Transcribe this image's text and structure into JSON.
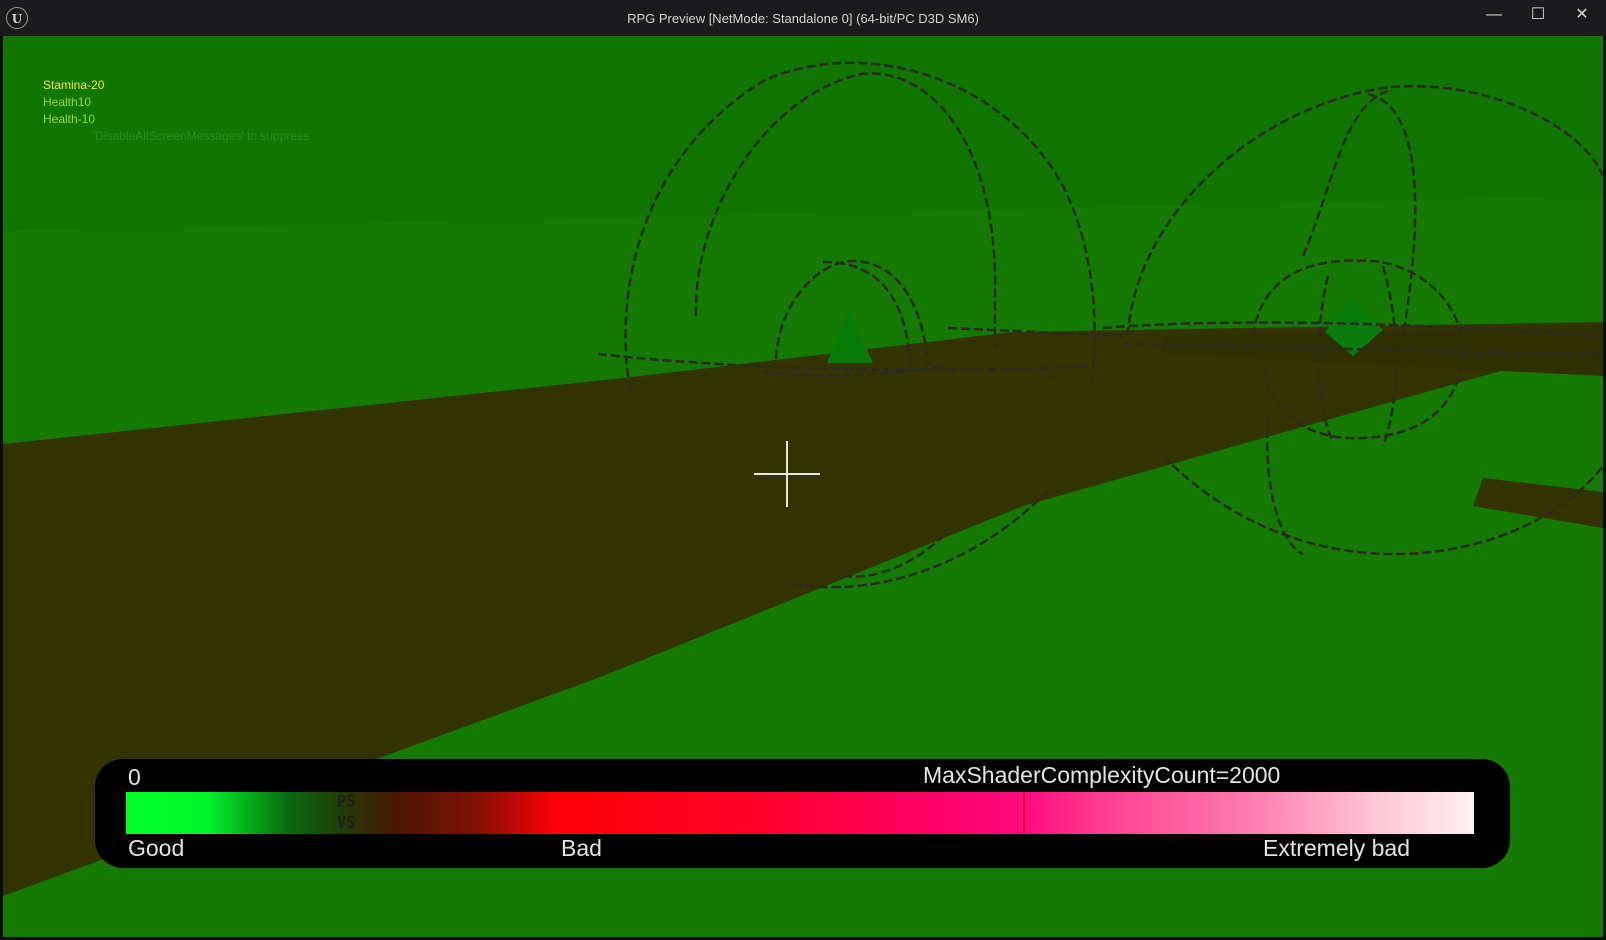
{
  "window": {
    "title": "RPG Preview [NetMode: Standalone 0]  (64-bit/PC D3D SM6)",
    "logo_text": "U",
    "minimize_glyph": "—",
    "maximize_glyph": "☐",
    "close_glyph": "✕"
  },
  "screen_messages": [
    {
      "text": "Stamina-20",
      "color": "#f0e840"
    },
    {
      "text": "Health10",
      "color": "#9ad83a"
    },
    {
      "text": "Health-10",
      "color": "#9ad83a"
    }
  ],
  "suppress_hint": "'DisableAllScreenMessages' to suppress",
  "shader_complexity": {
    "min_label": "0",
    "max_label": "MaxShaderComplexityCount=2000",
    "good_label": "Good",
    "bad_label": "Bad",
    "extremely_bad_label": "Extremely bad",
    "ps_label": "PS",
    "vs_label": "VS"
  },
  "colors": {
    "viewport_green": "#147a02",
    "floor_brown": "#333300",
    "titlebar": "#1b1b1d"
  },
  "icons": {
    "crosshair": "crosshair-icon",
    "logo": "unreal-logo-icon"
  }
}
